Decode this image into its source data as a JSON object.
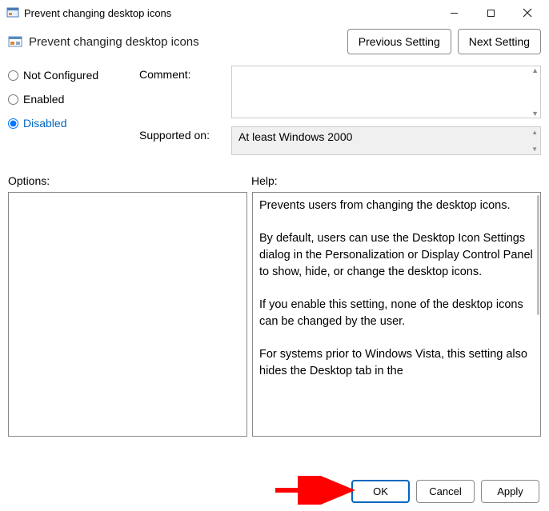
{
  "window": {
    "title": "Prevent changing desktop icons"
  },
  "header": {
    "policy_title": "Prevent changing desktop icons",
    "prev_btn": "Previous Setting",
    "next_btn": "Next Setting"
  },
  "radios": {
    "not_configured": "Not Configured",
    "enabled": "Enabled",
    "disabled": "Disabled",
    "selected": "disabled"
  },
  "fields": {
    "comment_label": "Comment:",
    "comment_value": "",
    "supported_label": "Supported on:",
    "supported_value": "At least Windows 2000"
  },
  "sections": {
    "options_label": "Options:",
    "help_label": "Help:"
  },
  "help": {
    "p1": "Prevents users from changing the desktop icons.",
    "p2": "By default, users can use the Desktop Icon Settings dialog in the Personalization or Display Control Panel to show, hide, or change the desktop icons.",
    "p3": "If you enable this setting, none of the desktop icons can be changed by the user.",
    "p4": "For systems prior to Windows Vista, this setting also hides the Desktop tab in the"
  },
  "footer": {
    "ok": "OK",
    "cancel": "Cancel",
    "apply": "Apply"
  }
}
